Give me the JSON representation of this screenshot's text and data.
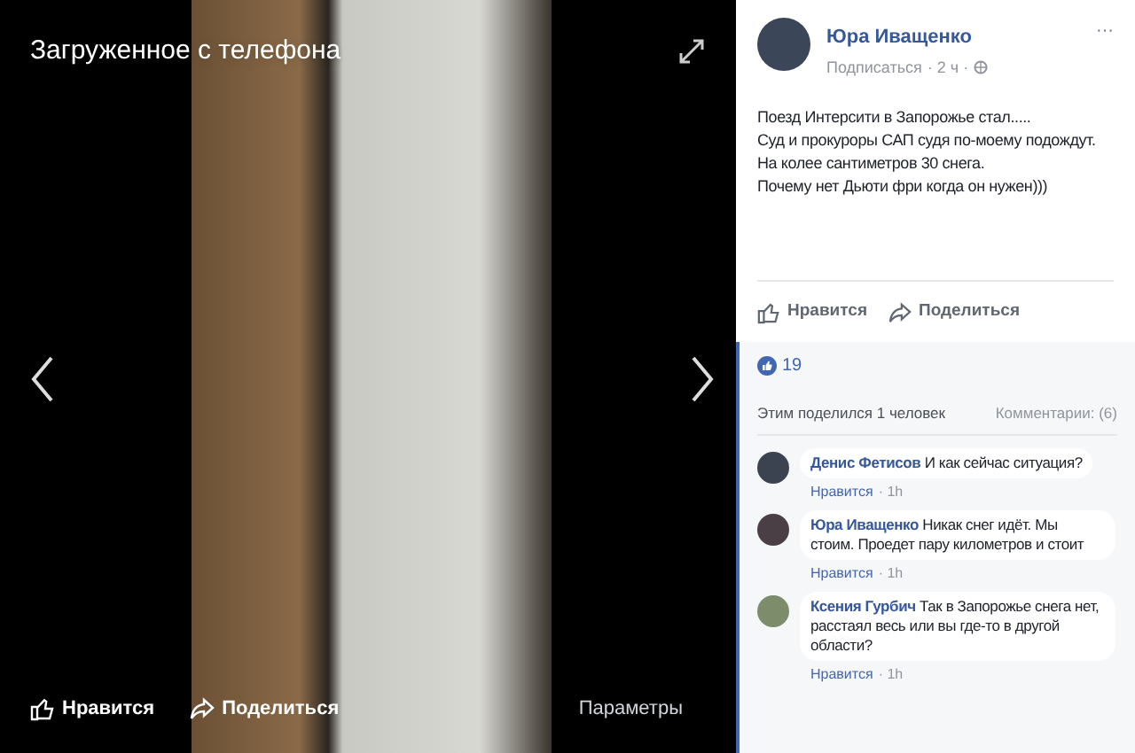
{
  "viewer": {
    "title": "Загруженное с телефона",
    "actions": [
      {
        "kind": "like",
        "label": "Нравится"
      },
      {
        "kind": "share",
        "label": "Поделиться"
      }
    ],
    "options": "Параметры"
  },
  "post": {
    "author": "Юра Иващенко",
    "follow": "Подписаться",
    "time": "· 2 ч ·",
    "more": "···",
    "text": [
      "Поезд Интерсити в Запорожье стал.....",
      "Суд и прокуроры САП судя по-моему подождут.",
      "На колее сантиметров 30 снега.",
      "Почему нет Дьюти фри когда он нужен)))"
    ],
    "actions": [
      {
        "kind": "like",
        "label": "Нравится"
      },
      {
        "kind": "share",
        "label": "Поделиться"
      }
    ],
    "likes": "19",
    "shares": "Этим поделился 1 человек",
    "comments_count": "Комментарии: (6)"
  },
  "comments": [
    {
      "author": "Денис Фетисов",
      "text": "И как сейчас ситуация?",
      "like": "Нравится",
      "time": "· 1h"
    },
    {
      "author": "Юра Иващенко",
      "text": "Никак снег идёт. Мы стоим. Проедет пару километров и стоит",
      "like": "Нравится",
      "time": "· 1h"
    },
    {
      "author": "Ксения Гурбич",
      "text": "Так в Запорожье снега нет, расстаял весь или вы где-то в другой области?",
      "like": "Нравится",
      "time": "· 1h"
    }
  ]
}
